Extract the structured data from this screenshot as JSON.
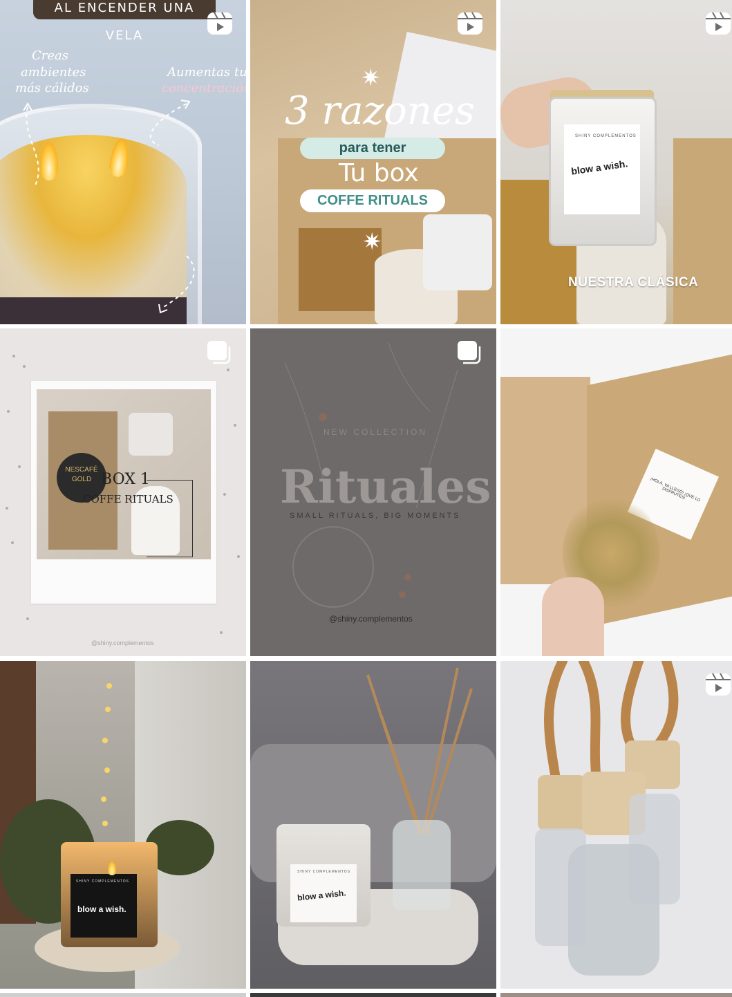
{
  "grid": {
    "tiles": [
      {
        "id": "t1",
        "type": "reel",
        "banner": "AL ENCENDER UNA VELA",
        "left_text": [
          "Creas",
          "ambientes",
          "más cálidos"
        ],
        "right_text": [
          "Aumentas tu",
          "concentración"
        ]
      },
      {
        "id": "t2",
        "type": "reel",
        "headline": "3 razones",
        "pill1": "para tener",
        "line2": "Tu box",
        "pill2": "COFFE RITUALS"
      },
      {
        "id": "t3",
        "type": "reel",
        "jar_label": "blow a wish.",
        "jar_brand": "SHINY COMPLEMENTOS",
        "caption": "NUESTRA CLÁSICA"
      },
      {
        "id": "t4",
        "type": "carousel",
        "box_title": "BOX 1",
        "box_subtitle": "COFFE RITUALS",
        "coffee_brand": "NESCAFÉ GOLD",
        "watermark": "@shiny.complementos"
      },
      {
        "id": "t5",
        "type": "carousel",
        "kicker": "NEW COLLECTION",
        "title": "Rituales",
        "subtitle": "SMALL RITUALS, BIG MOMENTS",
        "handle": "@shiny.complementos"
      },
      {
        "id": "t6",
        "type": "photo",
        "box_label": "¡HOLA, YA LLEGÓ! ¡QUE LO DISFRUTES!"
      },
      {
        "id": "t7",
        "type": "photo",
        "jar_label": "blow a wish.",
        "jar_brand": "SHINY COMPLEMENTOS"
      },
      {
        "id": "t8",
        "type": "photo",
        "jar_label": "blow a wish.",
        "jar_brand": "SHINY COMPLEMENTOS"
      },
      {
        "id": "t9",
        "type": "reel"
      }
    ]
  },
  "icons": {
    "reel": "reel-icon",
    "carousel": "carousel-icon"
  },
  "colors": {
    "pill_green": "#d5ebe6",
    "pill_white": "#ffffff",
    "banner": "#4a3b30"
  }
}
